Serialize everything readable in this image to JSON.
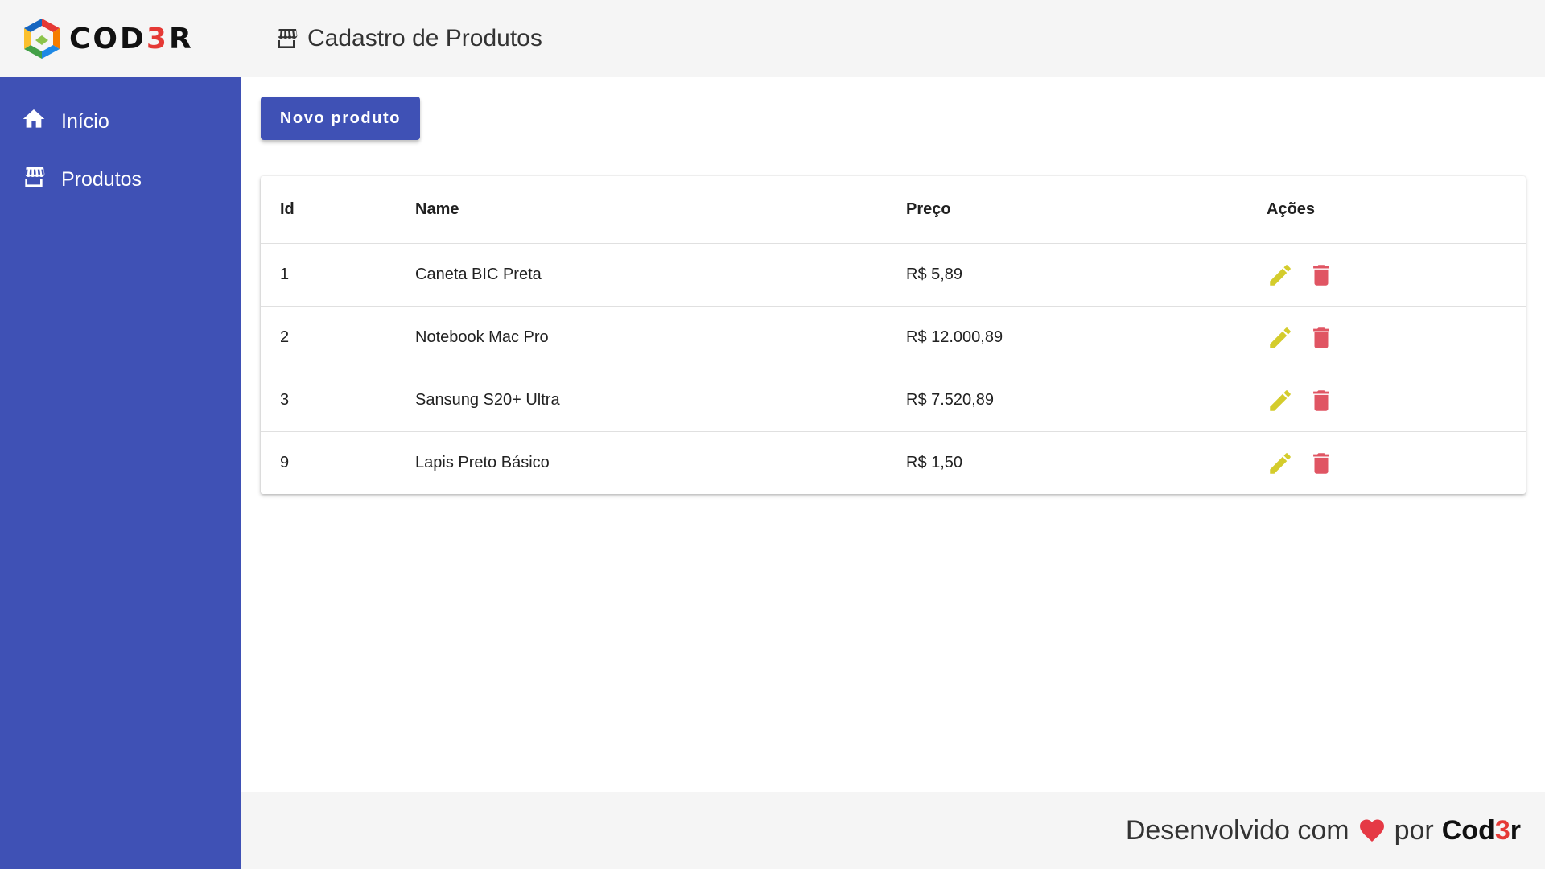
{
  "header": {
    "logo_text_part1": "COD",
    "logo_text_accent": "3",
    "logo_text_part2": "R",
    "page_title": "Cadastro de Produtos",
    "title_icon": "store-icon"
  },
  "sidebar": {
    "items": [
      {
        "label": "Início",
        "icon": "home-icon"
      },
      {
        "label": "Produtos",
        "icon": "store-icon"
      }
    ]
  },
  "main": {
    "new_button_label": "Novo produto",
    "table": {
      "headers": {
        "id": "Id",
        "name": "Name",
        "price": "Preço",
        "actions": "Ações"
      },
      "rows": [
        {
          "id": "1",
          "name": "Caneta BIC Preta",
          "price": "R$ 5,89"
        },
        {
          "id": "2",
          "name": "Notebook Mac Pro",
          "price": "R$ 12.000,89"
        },
        {
          "id": "3",
          "name": "Sansung S20+ Ultra",
          "price": "R$ 7.520,89"
        },
        {
          "id": "9",
          "name": "Lapis Preto Básico",
          "price": "R$ 1,50"
        }
      ]
    }
  },
  "footer": {
    "text": "Desenvolvido com",
    "by": "por",
    "brand_part1": "Cod",
    "brand_accent": "3",
    "brand_part2": "r"
  },
  "colors": {
    "primary": "#3f51b5",
    "edit": "#d4cc2c",
    "delete": "#e05563",
    "heart": "#e53945"
  }
}
